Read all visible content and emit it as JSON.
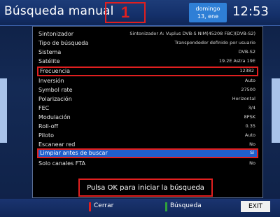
{
  "header": {
    "title": "Búsqueda manual",
    "marker": "1",
    "date_day": "domingo",
    "date_date": "13, ene",
    "time": "12:53"
  },
  "settings": [
    {
      "label": "Sintonizador",
      "value": "Sintonizador A: Vuplus DVB-S NIM(45208 FBC)(DVB-S2)"
    },
    {
      "label": "Tipo de búsqueda",
      "value": "Transpondedor definido por usuario"
    },
    {
      "label": "Sistema",
      "value": "DVB-S2"
    },
    {
      "label": "Satélite",
      "value": "19.2E Astra 19E"
    },
    {
      "label": "Frecuencia",
      "value": "12382"
    },
    {
      "label": "Inversión",
      "value": "Auto"
    },
    {
      "label": "Symbol rate",
      "value": "27500"
    },
    {
      "label": "Polarización",
      "value": "Horizontal"
    },
    {
      "label": "FEC",
      "value": "3/4"
    },
    {
      "label": "Modulación",
      "value": "8PSK"
    },
    {
      "label": "Roll-off",
      "value": "0.35"
    },
    {
      "label": "Piloto",
      "value": "Auto"
    },
    {
      "label": "Escanear red",
      "value": "No"
    },
    {
      "label": "Limpiar antes de buscar",
      "value": "Sí"
    },
    {
      "label": "Solo canales FTA",
      "value": "No"
    }
  ],
  "start_prompt": "Pulsa OK para iniciar la búsqueda",
  "footer": {
    "red_label": "Cerrar",
    "green_label": "Búsqueda",
    "exit_label": "EXIT"
  },
  "colors": {
    "red_key": "#e01f1f",
    "green_key": "#2fa33a",
    "selection": "#1f5fcc",
    "highlight_box": "#e01f1f"
  }
}
